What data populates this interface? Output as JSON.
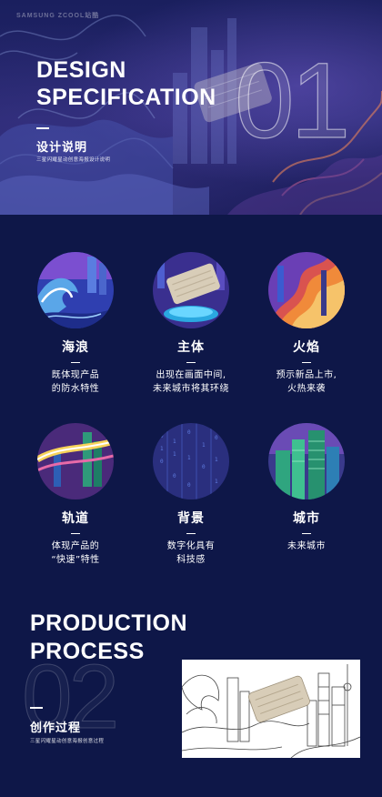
{
  "hero": {
    "brand": "SAMSUNG   ZCOOL站酷",
    "number": "01",
    "title_line1": "DESIGN",
    "title_line2": "SPECIFICATION",
    "title_cn": "设计说明",
    "subtitle_cn": "三星闪耀星动创意海报设计说明"
  },
  "elements": [
    {
      "name": "海浪",
      "desc": "既体现产品\n的防水特性",
      "icon": "wave-illustration"
    },
    {
      "name": "主体",
      "desc": "出现在画面中间,\n未来城市将其环绕",
      "icon": "ssd-product-illustration"
    },
    {
      "name": "火焰",
      "desc": "预示新品上市,\n火热来袭",
      "icon": "flame-illustration"
    },
    {
      "name": "轨道",
      "desc": "体现产品的\n“快速”特性",
      "icon": "track-illustration"
    },
    {
      "name": "背景",
      "desc": "数字化具有\n科技感",
      "icon": "digital-background-illustration"
    },
    {
      "name": "城市",
      "desc": "未来城市",
      "icon": "city-illustration"
    }
  ],
  "process": {
    "number": "02",
    "title_line1": "PRODUCTION",
    "title_line2": "PROCESS",
    "title_cn": "创作过程",
    "subtitle_cn": "三星闪耀星动创意海报创意过程",
    "sketch_icon": "line-sketch-illustration"
  },
  "colors": {
    "background": "#0e1748",
    "text": "#ffffff",
    "accent_orange": "#e8743a",
    "accent_purple": "#6a3fb5"
  }
}
